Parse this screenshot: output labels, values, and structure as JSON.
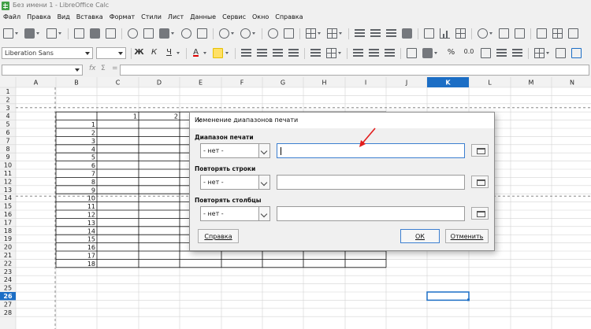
{
  "window": {
    "title": "Без имени 1 - LibreOffice Calc"
  },
  "menu": [
    "Файл",
    "Правка",
    "Вид",
    "Вставка",
    "Формат",
    "Стили",
    "Лист",
    "Данные",
    "Сервис",
    "Окно",
    "Справка"
  ],
  "formatting": {
    "font_name": "Liberation Sans",
    "font_size": "",
    "bold": "Ж",
    "italic": "К",
    "underline": "Ч",
    "font_color_glyph": "A",
    "percent": "%",
    "decimal": "0.0"
  },
  "formula_bar": {
    "name_box": "",
    "fx": "fx",
    "sum": "Σ",
    "equals": "=",
    "content": ""
  },
  "sheet": {
    "columns": [
      "A",
      "B",
      "C",
      "D",
      "E",
      "F",
      "G",
      "H",
      "I",
      "J",
      "K",
      "L",
      "M",
      "N"
    ],
    "rows": [
      "1",
      "2",
      "3",
      "4",
      "5",
      "6",
      "7",
      "8",
      "9",
      "10",
      "11",
      "12",
      "13",
      "14",
      "15",
      "16",
      "17",
      "18",
      "19",
      "20",
      "21",
      "22",
      "23",
      "24",
      "25",
      "26",
      "27",
      "28"
    ],
    "cells": [
      {
        "col": "C",
        "row": 4,
        "value": "1"
      },
      {
        "col": "D",
        "row": 4,
        "value": "2"
      },
      {
        "col": "B",
        "row": 5,
        "value": "1"
      },
      {
        "col": "B",
        "row": 6,
        "value": "2"
      },
      {
        "col": "B",
        "row": 7,
        "value": "3"
      },
      {
        "col": "B",
        "row": 8,
        "value": "4"
      },
      {
        "col": "B",
        "row": 9,
        "value": "5"
      },
      {
        "col": "B",
        "row": 10,
        "value": "6"
      },
      {
        "col": "B",
        "row": 11,
        "value": "7"
      },
      {
        "col": "B",
        "row": 12,
        "value": "8"
      },
      {
        "col": "B",
        "row": 13,
        "value": "9"
      },
      {
        "col": "B",
        "row": 14,
        "value": "10"
      },
      {
        "col": "B",
        "row": 15,
        "value": "11"
      },
      {
        "col": "B",
        "row": 16,
        "value": "12"
      },
      {
        "col": "B",
        "row": 17,
        "value": "13"
      },
      {
        "col": "B",
        "row": 18,
        "value": "14"
      },
      {
        "col": "B",
        "row": 19,
        "value": "15"
      },
      {
        "col": "B",
        "row": 20,
        "value": "16"
      },
      {
        "col": "B",
        "row": 21,
        "value": "17"
      },
      {
        "col": "B",
        "row": 22,
        "value": "18"
      }
    ],
    "active_cell": "K26",
    "active_column": "K",
    "active_row": "26"
  },
  "dialog": {
    "title": "Изменение диапазонов печати",
    "print_range_label": "Диапазон печати",
    "print_range_value": "- нет -",
    "repeat_rows_label": "Повторять строки",
    "repeat_rows_value": "- нет -",
    "repeat_cols_label": "Повторять столбцы",
    "repeat_cols_value": "- нет -",
    "help_button": "Справка",
    "ok_button": "ОК",
    "cancel_button": "Отменить"
  },
  "colors": {
    "accent": "#3c7fd0",
    "active_header": "#1c6ec5",
    "annotation_arrow": "#e21c1c",
    "app_icon": "#43a047"
  }
}
